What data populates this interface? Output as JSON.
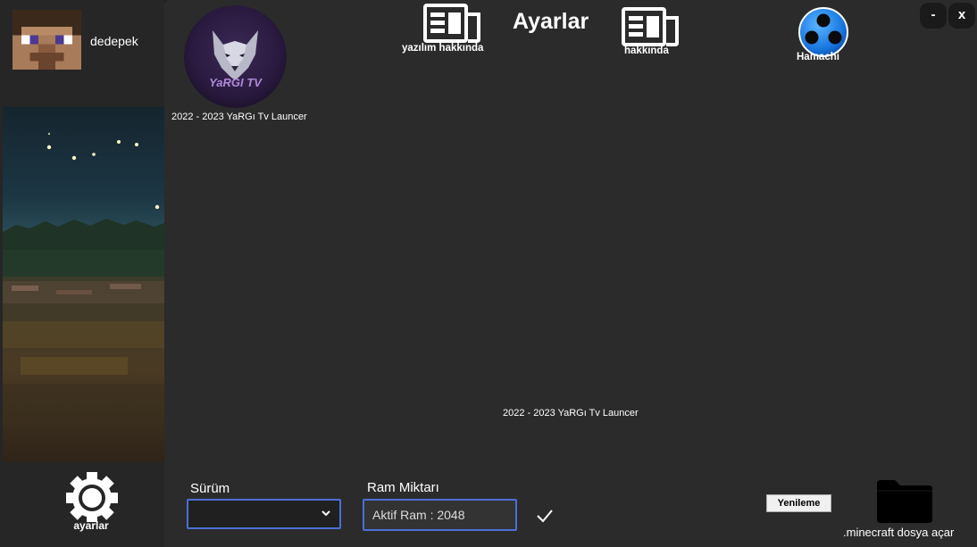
{
  "user": {
    "name": "dedepek"
  },
  "sidebar": {
    "settings_label": "ayarlar"
  },
  "header": {
    "title": "Ayarlar",
    "about_software_label": "yazılım hakkında",
    "about_label": "hakkında",
    "hamachi_label": "Hamachi"
  },
  "window": {
    "minimize_label": "-",
    "close_label": "x"
  },
  "main": {
    "copyright_top": "2022 - 2023 YaRGı Tv Launcer",
    "copyright_mid": "2022 - 2023 YaRGı Tv Launcer",
    "logo_text": "YaRGI TV"
  },
  "form": {
    "version_label": "Sürüm",
    "version_value": "",
    "ram_label": "Ram Miktarı",
    "ram_value": "Aktif Ram : 2048",
    "refresh_label": "Yenileme",
    "folder_label": ".minecraft dosya açar"
  },
  "colors": {
    "accent": "#4c6fd9",
    "background": "#2b2b2b",
    "sidebar": "#262626"
  },
  "icons": [
    "avatar",
    "gear-icon",
    "newspaper-icon",
    "hamachi-icon",
    "chevron-down-icon",
    "checkmark-icon",
    "folder-icon",
    "wolf-logo"
  ]
}
